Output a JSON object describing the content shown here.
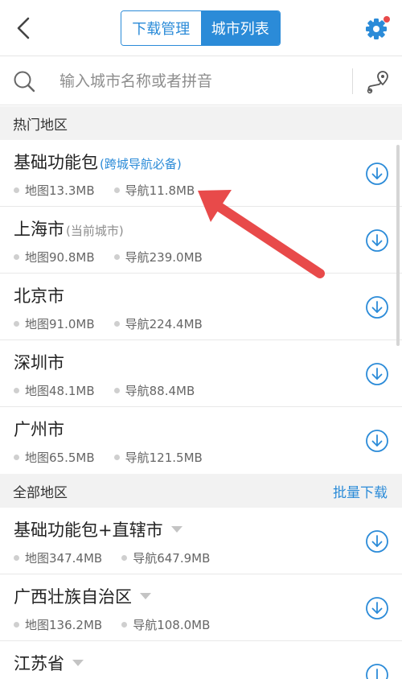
{
  "header": {
    "tab_download": "下载管理",
    "tab_city_list": "城市列表"
  },
  "search": {
    "placeholder": "输入城市名称或者拼音"
  },
  "hot_section": {
    "title": "热门地区",
    "items": [
      {
        "name": "基础功能包",
        "note": "(跨城导航必备)",
        "map": "地图13.3MB",
        "nav": "导航11.8MB"
      },
      {
        "name": "上海市",
        "note": "(当前城市)",
        "map": "地图90.8MB",
        "nav": "导航239.0MB"
      },
      {
        "name": "北京市",
        "map": "地图91.0MB",
        "nav": "导航224.4MB"
      },
      {
        "name": "深圳市",
        "map": "地图48.1MB",
        "nav": "导航88.4MB"
      },
      {
        "name": "广州市",
        "map": "地图65.5MB",
        "nav": "导航121.5MB"
      }
    ]
  },
  "all_section": {
    "title": "全部地区",
    "batch_download": "批量下载",
    "items": [
      {
        "name": "基础功能包+直辖市",
        "map": "地图347.4MB",
        "nav": "导航647.9MB"
      },
      {
        "name": "广西壮族自治区",
        "map": "地图136.2MB",
        "nav": "导航108.0MB"
      },
      {
        "name": "江苏省"
      }
    ]
  },
  "colors": {
    "accent": "#2b8bd8",
    "annotation_arrow": "#e84a4a",
    "notification_dot": "#e84a4a"
  }
}
